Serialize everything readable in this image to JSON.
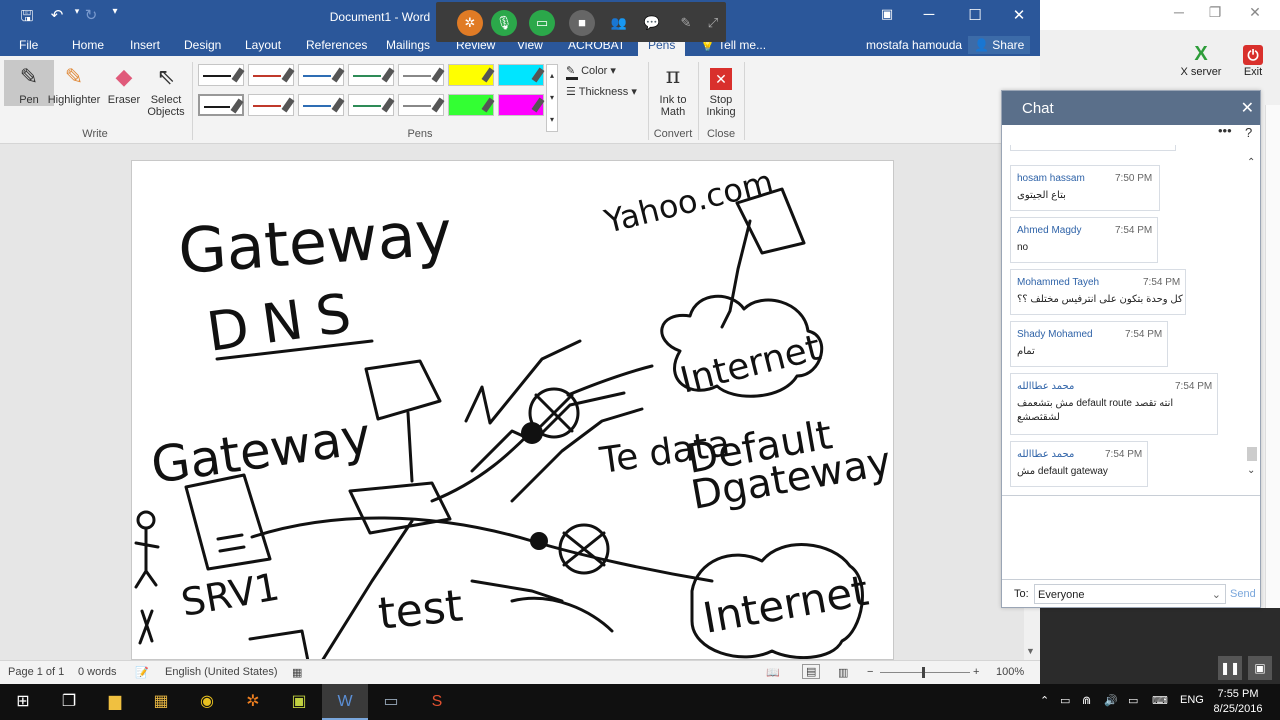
{
  "background_app": {
    "tools": [
      {
        "label": "X server",
        "icon": "x-server-icon"
      },
      {
        "label": "Exit",
        "icon": "power-icon"
      }
    ]
  },
  "word": {
    "title": "Document1 - Word",
    "tabs": [
      "File",
      "Home",
      "Insert",
      "Design",
      "Layout",
      "References",
      "Mailings",
      "Review",
      "View",
      "ACROBAT",
      "Pens"
    ],
    "active_tab": "Pens",
    "tell_me": "Tell me...",
    "user": "mostafa hamouda",
    "share": "Share",
    "ribbon": {
      "write_tools": [
        "Pen",
        "Highlighter",
        "Eraser",
        "Select Objects"
      ],
      "write_group": "Write",
      "pens_group": "Pens",
      "color_label": "Color",
      "thickness_label": "Thickness",
      "convert_tool": "Ink to Math",
      "convert_group": "Convert",
      "close_tool": "Stop Inking",
      "close_group": "Close",
      "pens_row1": [
        "#1a1a1a",
        "#c0392b",
        "#2e6db4",
        "#2e8b57",
        "#888888",
        "#ffff00",
        "#00e5ff"
      ],
      "pens_row2": [
        "#1a1a1a",
        "#c0392b",
        "#2e6db4",
        "#2e8b57",
        "#888888",
        "#33ff33",
        "#ff00ff"
      ]
    },
    "status": {
      "page": "Page 1 of 1",
      "words": "0 words",
      "language": "English (United States)",
      "zoom": "100%"
    },
    "ink_text": [
      "Gateway",
      "DNS",
      "Yahoo.com",
      "Gateway",
      "Internet",
      "Te data",
      "Default",
      "Dgateway",
      "SRV1",
      "test",
      "Internet"
    ]
  },
  "chat": {
    "title": "Chat",
    "messages": [
      {
        "name": "hosam hassam",
        "time": "7:50 PM",
        "text": "بتاع الجيتوى"
      },
      {
        "name": "Ahmed Magdy",
        "time": "7:54 PM",
        "text": "no"
      },
      {
        "name": "Mohammed Tayeh",
        "time": "7:54 PM",
        "text": "كل وحدة بتكون على انترفيس مختلف ؟؟"
      },
      {
        "name": "Shady Mohamed",
        "time": "7:54 PM",
        "text": "تمام"
      },
      {
        "name": "محمد عطاالله",
        "time": "7:54 PM",
        "text": "مش بتشعمف default route انته تقصد",
        "text2": "لشقثصشع"
      },
      {
        "name": "محمد عطاالله",
        "time": "7:54 PM",
        "text": "مش default gateway"
      }
    ],
    "to_label": "To:",
    "to_value": "Everyone",
    "send_label": "Send"
  },
  "taskbar": {
    "language": "ENG",
    "time": "7:55 PM",
    "date": "8/25/2016"
  }
}
